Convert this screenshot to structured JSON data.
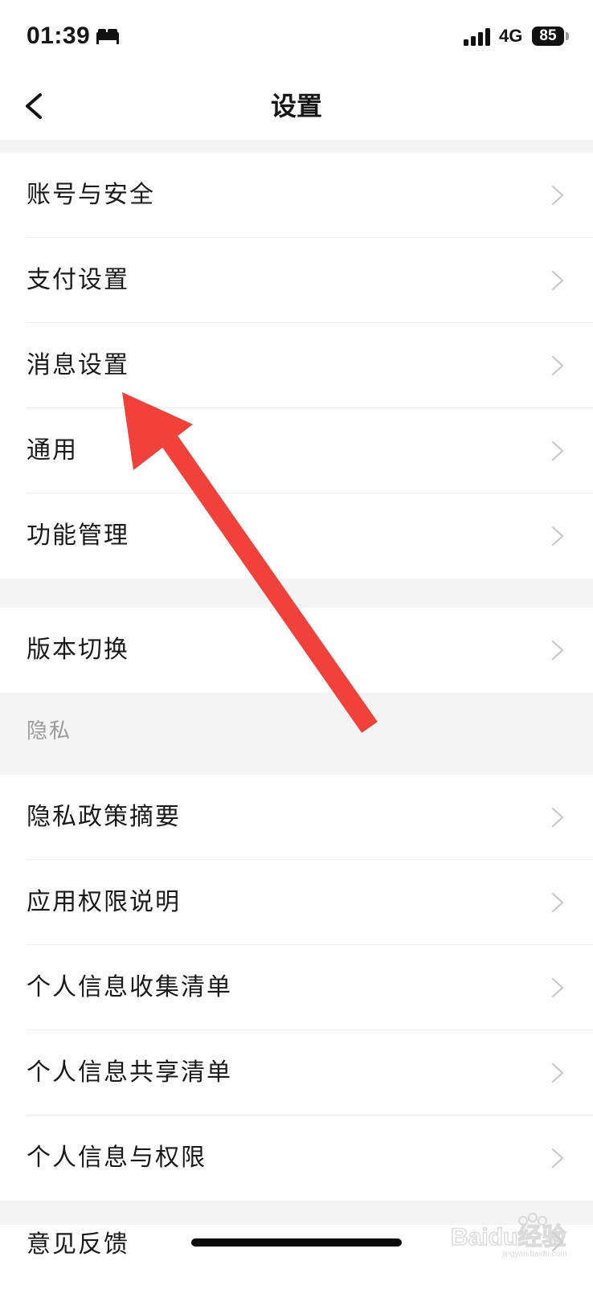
{
  "status_bar": {
    "time": "01:39",
    "sleep_icon": "bed-icon",
    "network": "4G",
    "battery": "85"
  },
  "nav": {
    "back_icon": "chevron-left-icon",
    "title": "设置"
  },
  "groups": [
    {
      "items": [
        {
          "label": "账号与安全"
        },
        {
          "label": "支付设置"
        },
        {
          "label": "消息设置"
        },
        {
          "label": "通用"
        },
        {
          "label": "功能管理"
        }
      ]
    },
    {
      "items": [
        {
          "label": "版本切换"
        }
      ]
    },
    {
      "header": "隐私",
      "items": [
        {
          "label": "隐私政策摘要"
        },
        {
          "label": "应用权限说明"
        },
        {
          "label": "个人信息收集清单"
        },
        {
          "label": "个人信息共享清单"
        },
        {
          "label": "个人信息与权限"
        }
      ]
    },
    {
      "items": [
        {
          "label": "意见反馈"
        }
      ]
    }
  ],
  "annotation": {
    "arrow_color": "#f2413b",
    "points_to": "消息设置"
  },
  "watermark": {
    "text": "Baidu经验",
    "subtext": "jingyan.baidu.com"
  },
  "colors": {
    "background": "#f4f4f4",
    "surface": "#ffffff",
    "text": "#1a1a1a",
    "muted": "#9a9a9a",
    "chevron": "#c8c8c8"
  }
}
